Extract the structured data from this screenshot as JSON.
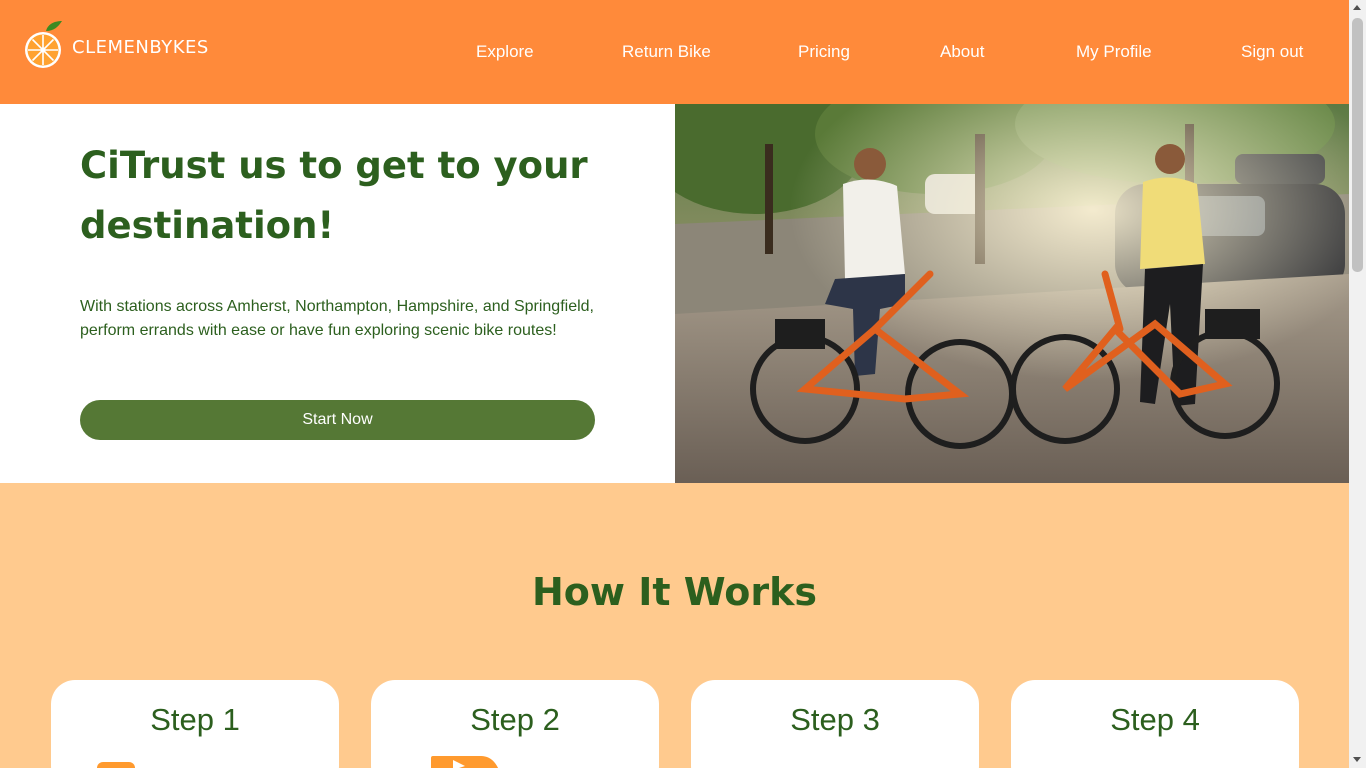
{
  "brand": {
    "name": "CLEMENBYKES"
  },
  "nav": {
    "explore": "Explore",
    "return_bike": "Return Bike",
    "pricing": "Pricing",
    "about": "About",
    "profile": "My Profile",
    "signout": "Sign out"
  },
  "hero": {
    "title": "CiTrust us to get to your destination!",
    "description": "With stations across Amherst, Northampton, Hampshire, and Springfield, perform errands with ease or have fun exploring scenic bike routes!",
    "cta": "Start Now"
  },
  "how_it_works": {
    "title": "How It Works",
    "steps": [
      {
        "title": "Step 1"
      },
      {
        "title": "Step 2"
      },
      {
        "title": "Step 3"
      },
      {
        "title": "Step 4"
      }
    ]
  },
  "colors": {
    "nav_bg": "#ff8a3a",
    "heading_green": "#2c5f1e",
    "button_green": "#557835",
    "section_peach": "#ffca8e"
  }
}
